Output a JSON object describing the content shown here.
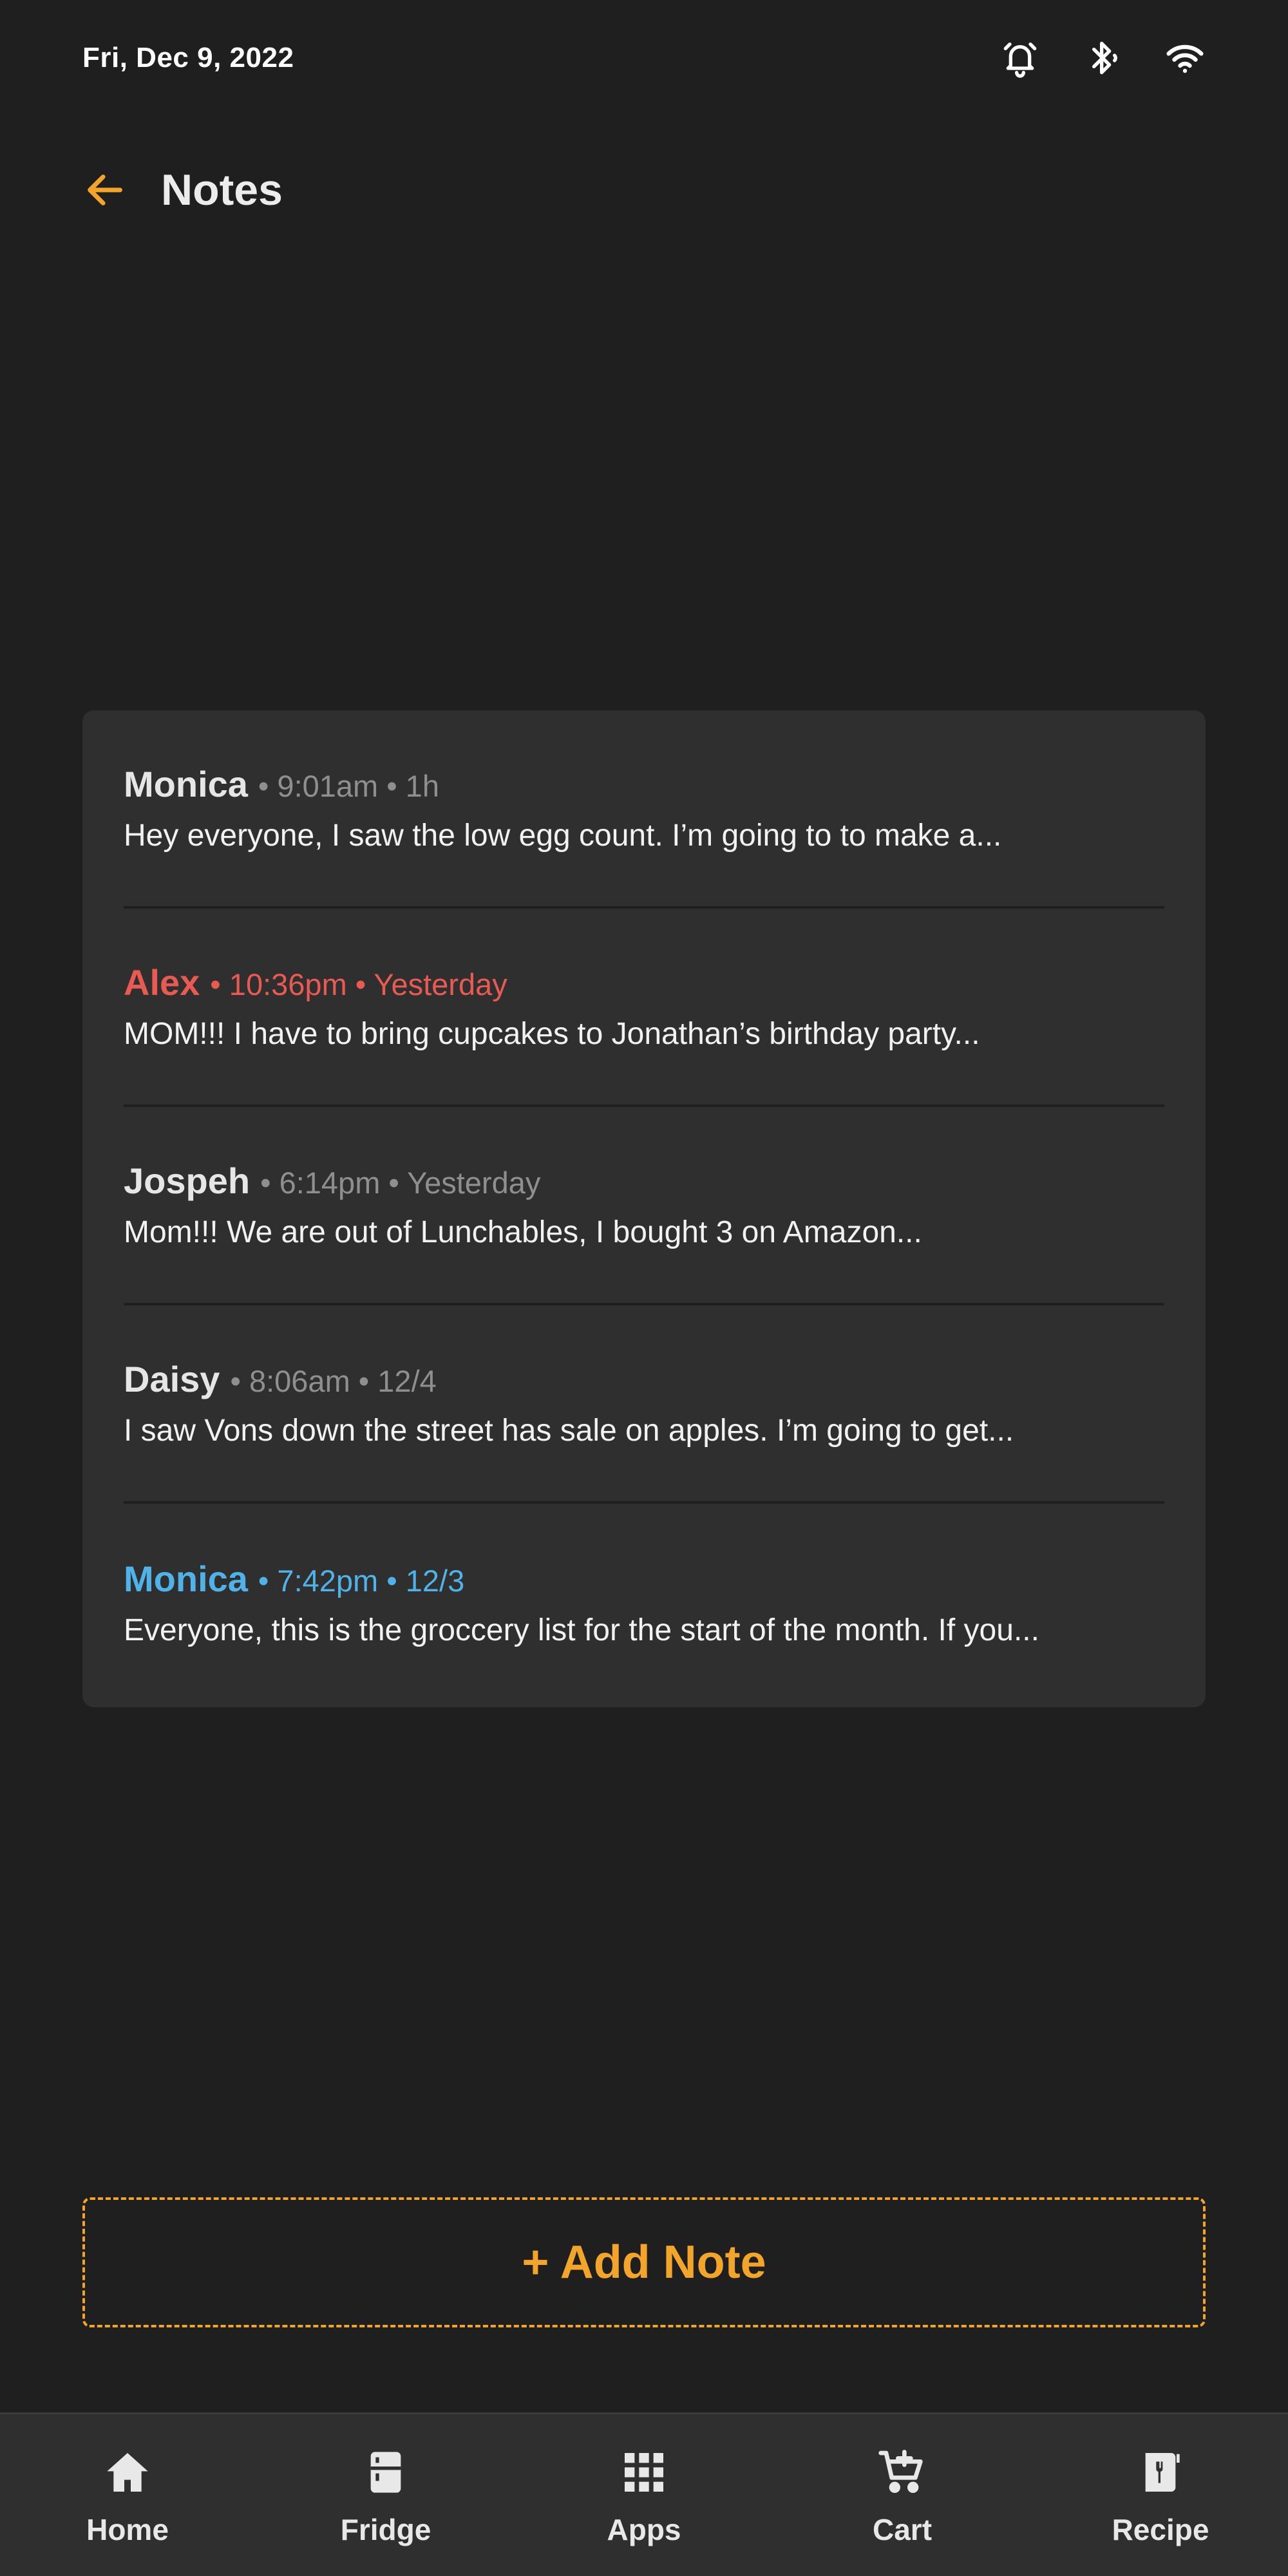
{
  "status_bar": {
    "date": "Fri, Dec 9, 2022",
    "icons": [
      "alarm-icon",
      "bluetooth-icon",
      "wifi-icon"
    ]
  },
  "header": {
    "title": "Notes",
    "back_icon": "arrow-left-icon"
  },
  "colors": {
    "background": "#1f1f1f",
    "card": "#2f2f2f",
    "accent_orange": "#f3a52a",
    "alex_red": "#e85a52",
    "monica_blue": "#4fb3ea",
    "meta_gray": "#8f8f8f"
  },
  "notes": [
    {
      "author": "Monica",
      "meta": "• 9:01am • 1h",
      "preview": "Hey everyone, I saw the low egg count. I’m going to to make a..."
    },
    {
      "author": "Alex",
      "meta": "• 10:36pm • Yesterday",
      "preview": "MOM!!! I have to bring cupcakes to Jonathan’s birthday party...",
      "highlight": "red"
    },
    {
      "author": "Jospeh",
      "meta": "• 6:14pm • Yesterday",
      "preview": "Mom!!! We are out of Lunchables, I bought 3 on Amazon..."
    },
    {
      "author": "Daisy",
      "meta": "• 8:06am • 12/4",
      "preview": "I saw Vons down the street has sale on apples. I’m going to get..."
    },
    {
      "author": "Monica",
      "meta": "• 7:42pm • 12/3",
      "preview": "Everyone, this is the groccery list for the start of the month. If you...",
      "highlight": "blue"
    }
  ],
  "add_note": {
    "label": "+ Add Note"
  },
  "bottom_nav": {
    "items": [
      {
        "label": "Home",
        "icon": "home-icon"
      },
      {
        "label": "Fridge",
        "icon": "fridge-icon"
      },
      {
        "label": "Apps",
        "icon": "apps-grid-icon"
      },
      {
        "label": "Cart",
        "icon": "cart-icon"
      },
      {
        "label": "Recipe",
        "icon": "recipe-book-icon"
      }
    ]
  }
}
